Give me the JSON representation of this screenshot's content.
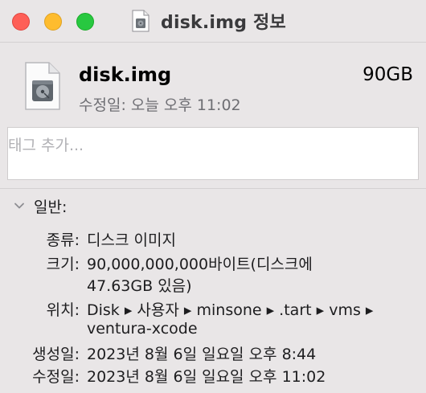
{
  "window": {
    "title": "disk.img 정보"
  },
  "header": {
    "file_name": "disk.img",
    "file_size": "90GB",
    "modified_line": "수정일: 오늘 오후 11:02"
  },
  "tags": {
    "placeholder": "태그 추가..."
  },
  "general": {
    "section_label": "일반:",
    "kind_label": "종류:",
    "kind_value": "디스크 이미지",
    "size_label": "크기:",
    "size_value_line1": "90,000,000,000바이트(디스크에",
    "size_value_line2": "47.63GB 있음)",
    "where_label": "위치:",
    "where_value_line1": "Disk ▸ 사용자 ▸ minsone ▸ .tart ▸ vms ▸",
    "where_value_line2": "ventura-xcode",
    "created_label": "생성일:",
    "created_value": "2023년 8월 6일 일요일 오후 8:44",
    "modified_label": "수정일:",
    "modified_value": "2023년 8월 6일 일요일 오후 11:02"
  },
  "icons": {
    "close": "close-button",
    "minimize": "minimize-button",
    "zoom": "zoom-button",
    "title_file": "disk-image-icon",
    "file": "disk-image-icon",
    "disclosure": "chevron-down-icon"
  },
  "colors": {
    "close": "#fe5f57",
    "minimize": "#febc2e",
    "zoom": "#28c840",
    "background": "#e9e6e7",
    "secondary_text": "#6e6e73"
  }
}
